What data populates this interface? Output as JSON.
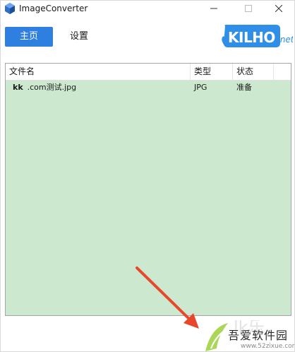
{
  "window": {
    "title": "ImageConverter",
    "controls": {
      "minimize": "—",
      "maximize": "☐",
      "close": "✕"
    }
  },
  "nav": {
    "home_label": "主页",
    "settings_label": "设置"
  },
  "logo": {
    "brand": "KILHO",
    "suffix": ".net"
  },
  "table": {
    "columns": [
      "文件名",
      "类型",
      "状态"
    ],
    "rows": [
      {
        "name_prefix": "kk",
        "name": ".com测试.jpg",
        "type": "JPG",
        "status": "准备"
      }
    ]
  },
  "watermark": {
    "text": "吾爱软件园",
    "url": "www.52zixue.com"
  },
  "colors": {
    "accent": "#2f7fe0",
    "table_bg": "#cce8cf",
    "arrow": "#e8472b"
  }
}
